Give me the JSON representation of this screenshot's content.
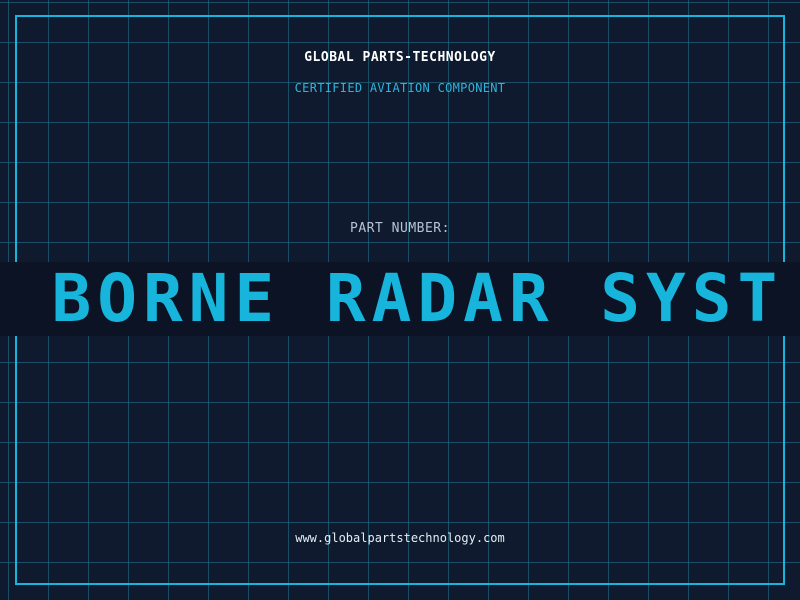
{
  "header": {
    "company": "GLOBAL PARTS-TECHNOLOGY",
    "subtitle": "CERTIFIED AVIATION COMPONENT"
  },
  "part": {
    "label": "PART NUMBER:",
    "value": "P BORNE RADAR SYST"
  },
  "footer": {
    "website": "www.globalpartstechnology.com"
  },
  "colors": {
    "background": "#101a2e",
    "grid": "#227896",
    "accent": "#17b4dc",
    "band": "#0b1324"
  }
}
